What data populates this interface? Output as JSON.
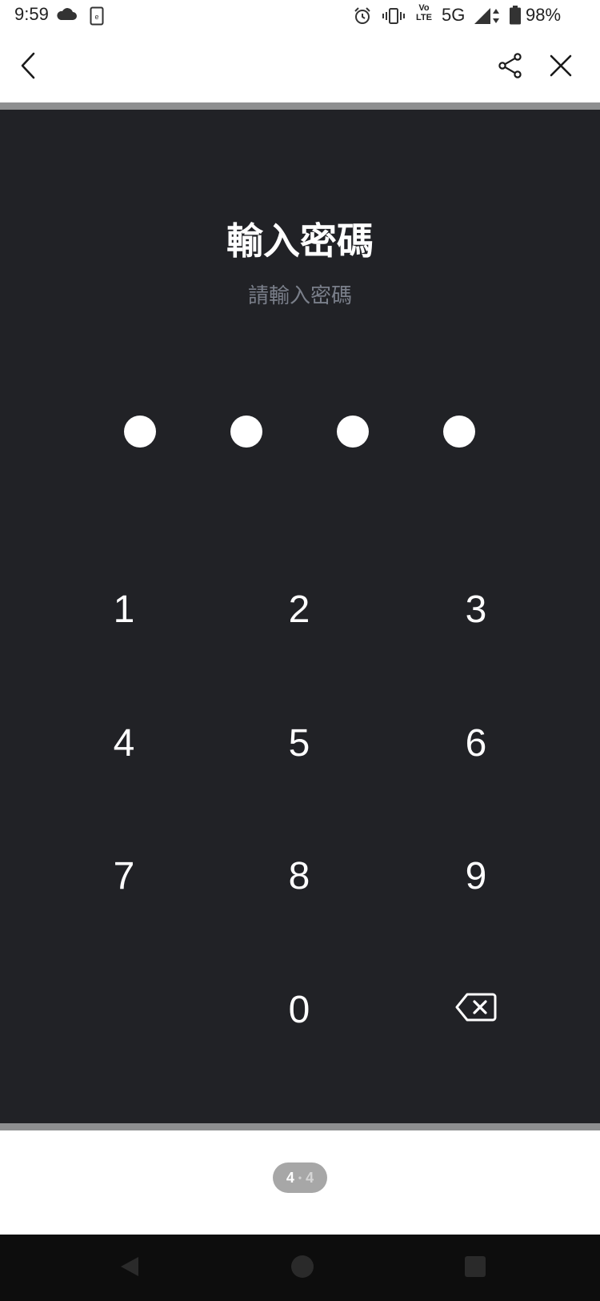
{
  "status_bar": {
    "time": "9:59",
    "volte_top": "Vo",
    "volte_bottom": "LTE",
    "network": "5G",
    "battery": "98%",
    "icons": [
      "cloud-icon",
      "app-notification-icon",
      "alarm-icon",
      "vibrate-icon",
      "volte-icon",
      "signal-icon",
      "battery-icon"
    ]
  },
  "app_bar": {
    "icons": [
      "back-arrow-icon",
      "share-icon",
      "close-icon"
    ]
  },
  "passcode": {
    "title": "輸入密碼",
    "subtitle": "請輸入密碼",
    "digits_entered": 4
  },
  "keypad": {
    "keys": [
      "1",
      "2",
      "3",
      "4",
      "5",
      "6",
      "7",
      "8",
      "9",
      "0"
    ],
    "delete_icon": "backspace-icon"
  },
  "pager": {
    "current": "4",
    "separator": "•",
    "total": "4"
  },
  "nav_bar": {
    "icons": [
      "nav-back-icon",
      "nav-home-icon",
      "nav-recents-icon"
    ]
  },
  "colors": {
    "background_dark": "#212226",
    "text_primary": "#ffffff",
    "text_secondary": "#7a7f8a",
    "divider": "#8e8f90"
  }
}
